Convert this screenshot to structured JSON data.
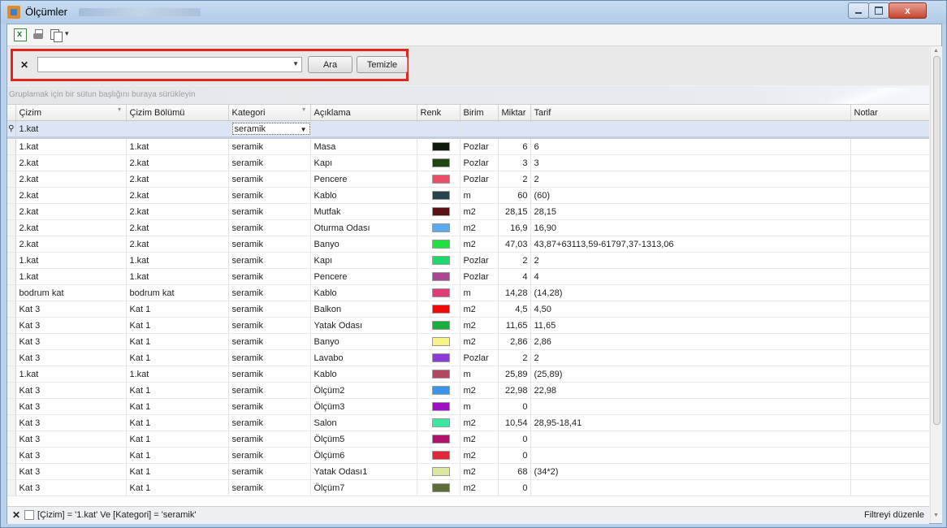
{
  "window": {
    "title": "Ölçümler",
    "close_glyph": "x"
  },
  "toolbar": {
    "dropdown_glyph": "▾"
  },
  "search": {
    "value": "",
    "search_label": "Ara",
    "clear_label": "Temizle",
    "close_glyph": "✕"
  },
  "group_panel": {
    "hint": "Gruplamak için bir sütun başlığını buraya sürükleyin"
  },
  "columns": [
    "Çizim",
    "Çizim Bölümü",
    "Kategori",
    "Açıklama",
    "Renk",
    "Birim",
    "Miktar",
    "Tarif",
    "Notlar"
  ],
  "auto_filter": {
    "cizim": "1.kat",
    "kategori": "seramik"
  },
  "rows": [
    {
      "cizim": "1.kat",
      "bolum": "1.kat",
      "kategori": "seramik",
      "aciklama": "Masa",
      "renk": "#0e1a0e",
      "birim": "Pozlar",
      "miktar": "6",
      "tarif": "6",
      "notlar": ""
    },
    {
      "cizim": "2.kat",
      "bolum": "2.kat",
      "kategori": "seramik",
      "aciklama": "Kapı",
      "renk": "#1f4512",
      "birim": "Pozlar",
      "miktar": "3",
      "tarif": "3",
      "notlar": ""
    },
    {
      "cizim": "2.kat",
      "bolum": "2.kat",
      "kategori": "seramik",
      "aciklama": "Pencere",
      "renk": "#e8506a",
      "birim": "Pozlar",
      "miktar": "2",
      "tarif": "2",
      "notlar": ""
    },
    {
      "cizim": "2.kat",
      "bolum": "2.kat",
      "kategori": "seramik",
      "aciklama": "Kablo",
      "renk": "#26424a",
      "birim": "m",
      "miktar": "60",
      "tarif": "(60)",
      "notlar": ""
    },
    {
      "cizim": "2.kat",
      "bolum": "2.kat",
      "kategori": "seramik",
      "aciklama": "Mutfak",
      "renk": "#5a1212",
      "birim": "m2",
      "miktar": "28,15",
      "tarif": "28,15",
      "notlar": ""
    },
    {
      "cizim": "2.kat",
      "bolum": "2.kat",
      "kategori": "seramik",
      "aciklama": "Oturma Odası",
      "renk": "#5aaaf0",
      "birim": "m2",
      "miktar": "16,9",
      "tarif": "16,90",
      "notlar": ""
    },
    {
      "cizim": "2.kat",
      "bolum": "2.kat",
      "kategori": "seramik",
      "aciklama": "Banyo",
      "renk": "#22e040",
      "birim": "m2",
      "miktar": "47,03",
      "tarif": "43,87+63113,59-61797,37-1313,06",
      "notlar": ""
    },
    {
      "cizim": "1.kat",
      "bolum": "1.kat",
      "kategori": "seramik",
      "aciklama": "Kapı",
      "renk": "#1ed86e",
      "birim": "Pozlar",
      "miktar": "2",
      "tarif": "2",
      "notlar": ""
    },
    {
      "cizim": "1.kat",
      "bolum": "1.kat",
      "kategori": "seramik",
      "aciklama": "Pencere",
      "renk": "#a84892",
      "birim": "Pozlar",
      "miktar": "4",
      "tarif": "4",
      "notlar": ""
    },
    {
      "cizim": "bodrum kat",
      "bolum": "bodrum kat",
      "kategori": "seramik",
      "aciklama": "Kablo",
      "renk": "#e03c78",
      "birim": "m",
      "miktar": "14,28",
      "tarif": "(14,28)",
      "notlar": ""
    },
    {
      "cizim": "Kat 3",
      "bolum": "Kat 1",
      "kategori": "seramik",
      "aciklama": "Balkon",
      "renk": "#f00a0a",
      "birim": "m2",
      "miktar": "4,5",
      "tarif": "4,50",
      "notlar": ""
    },
    {
      "cizim": "Kat 3",
      "bolum": "Kat 1",
      "kategori": "seramik",
      "aciklama": "Yatak Odası",
      "renk": "#1cae3c",
      "birim": "m2",
      "miktar": "11,65",
      "tarif": "11,65",
      "notlar": ""
    },
    {
      "cizim": "Kat 3",
      "bolum": "Kat 1",
      "kategori": "seramik",
      "aciklama": "Banyo",
      "renk": "#f8f088",
      "birim": "m2",
      "miktar": "2,86",
      "tarif": "2,86",
      "notlar": ""
    },
    {
      "cizim": "Kat 3",
      "bolum": "Kat 1",
      "kategori": "seramik",
      "aciklama": "Lavabo",
      "renk": "#8a3cd8",
      "birim": "Pozlar",
      "miktar": "2",
      "tarif": "2",
      "notlar": ""
    },
    {
      "cizim": "1.kat",
      "bolum": "1.kat",
      "kategori": "seramik",
      "aciklama": "Kablo",
      "renk": "#b04860",
      "birim": "m",
      "miktar": "25,89",
      "tarif": "(25,89)",
      "notlar": ""
    },
    {
      "cizim": "Kat 3",
      "bolum": "Kat 1",
      "kategori": "seramik",
      "aciklama": "Ölçüm2",
      "renk": "#3a96e8",
      "birim": "m2",
      "miktar": "22,98",
      "tarif": "22,98",
      "notlar": ""
    },
    {
      "cizim": "Kat 3",
      "bolum": "Kat 1",
      "kategori": "seramik",
      "aciklama": "Ölçüm3",
      "renk": "#a010c0",
      "birim": "m",
      "miktar": "0",
      "tarif": "",
      "notlar": ""
    },
    {
      "cizim": "Kat 3",
      "bolum": "Kat 1",
      "kategori": "seramik",
      "aciklama": "Salon",
      "renk": "#3ce8a0",
      "birim": "m2",
      "miktar": "10,54",
      "tarif": "28,95-18,41",
      "notlar": ""
    },
    {
      "cizim": "Kat 3",
      "bolum": "Kat 1",
      "kategori": "seramik",
      "aciklama": "Ölçüm5",
      "renk": "#b0146a",
      "birim": "m2",
      "miktar": "0",
      "tarif": "",
      "notlar": ""
    },
    {
      "cizim": "Kat 3",
      "bolum": "Kat 1",
      "kategori": "seramik",
      "aciklama": "Ölçüm6",
      "renk": "#e02838",
      "birim": "m2",
      "miktar": "0",
      "tarif": "",
      "notlar": ""
    },
    {
      "cizim": "Kat 3",
      "bolum": "Kat 1",
      "kategori": "seramik",
      "aciklama": "Yatak Odası1",
      "renk": "#dce8a0",
      "birim": "m2",
      "miktar": "68",
      "tarif": "(34*2)",
      "notlar": ""
    },
    {
      "cizim": "Kat 3",
      "bolum": "Kat 1",
      "kategori": "seramik",
      "aciklama": "Ölçüm7",
      "renk": "#5e6c3a",
      "birim": "m2",
      "miktar": "0",
      "tarif": "",
      "notlar": ""
    }
  ],
  "filter_panel": {
    "expression": "[Çizim] = '1.kat' Ve [Kategori] = 'seramik'",
    "edit_label": "Filtreyi düzenle",
    "close_glyph": "✕"
  }
}
